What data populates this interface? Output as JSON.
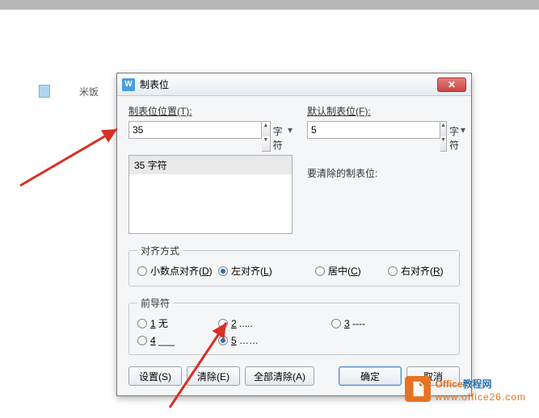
{
  "doc_text": "米饭",
  "dialog": {
    "title": "制表位",
    "tab_pos_label": "制表位位置(T):",
    "tab_pos_value": "35",
    "tab_pos_unit": "字符",
    "default_label": "默认制表位(F):",
    "default_value": "5",
    "default_unit": "字符",
    "list_item": "35 字符",
    "clear_label": "要清除的制表位:"
  },
  "align": {
    "legend": "对齐方式",
    "options": [
      {
        "label": "小数点对齐(D)",
        "checked": false
      },
      {
        "label": "左对齐(L)",
        "checked": true
      },
      {
        "label": "居中(C)",
        "checked": false
      },
      {
        "label": "右对齐(R)",
        "checked": false
      }
    ]
  },
  "leader": {
    "legend": "前导符",
    "options": [
      {
        "label": "1 无",
        "checked": false
      },
      {
        "label": "2 .....",
        "checked": false
      },
      {
        "label": "3 ----",
        "checked": false
      },
      {
        "label": "4 ___",
        "checked": false
      },
      {
        "label": "5 ……",
        "checked": true
      }
    ]
  },
  "buttons": {
    "set": "设置(S)",
    "clear": "清除(E)",
    "clear_all": "全部清除(A)",
    "ok": "确定",
    "cancel": "取消"
  },
  "logo": {
    "line1_accent": "Office",
    "line1_rest": "教程网",
    "line2": "www.office26.com"
  }
}
